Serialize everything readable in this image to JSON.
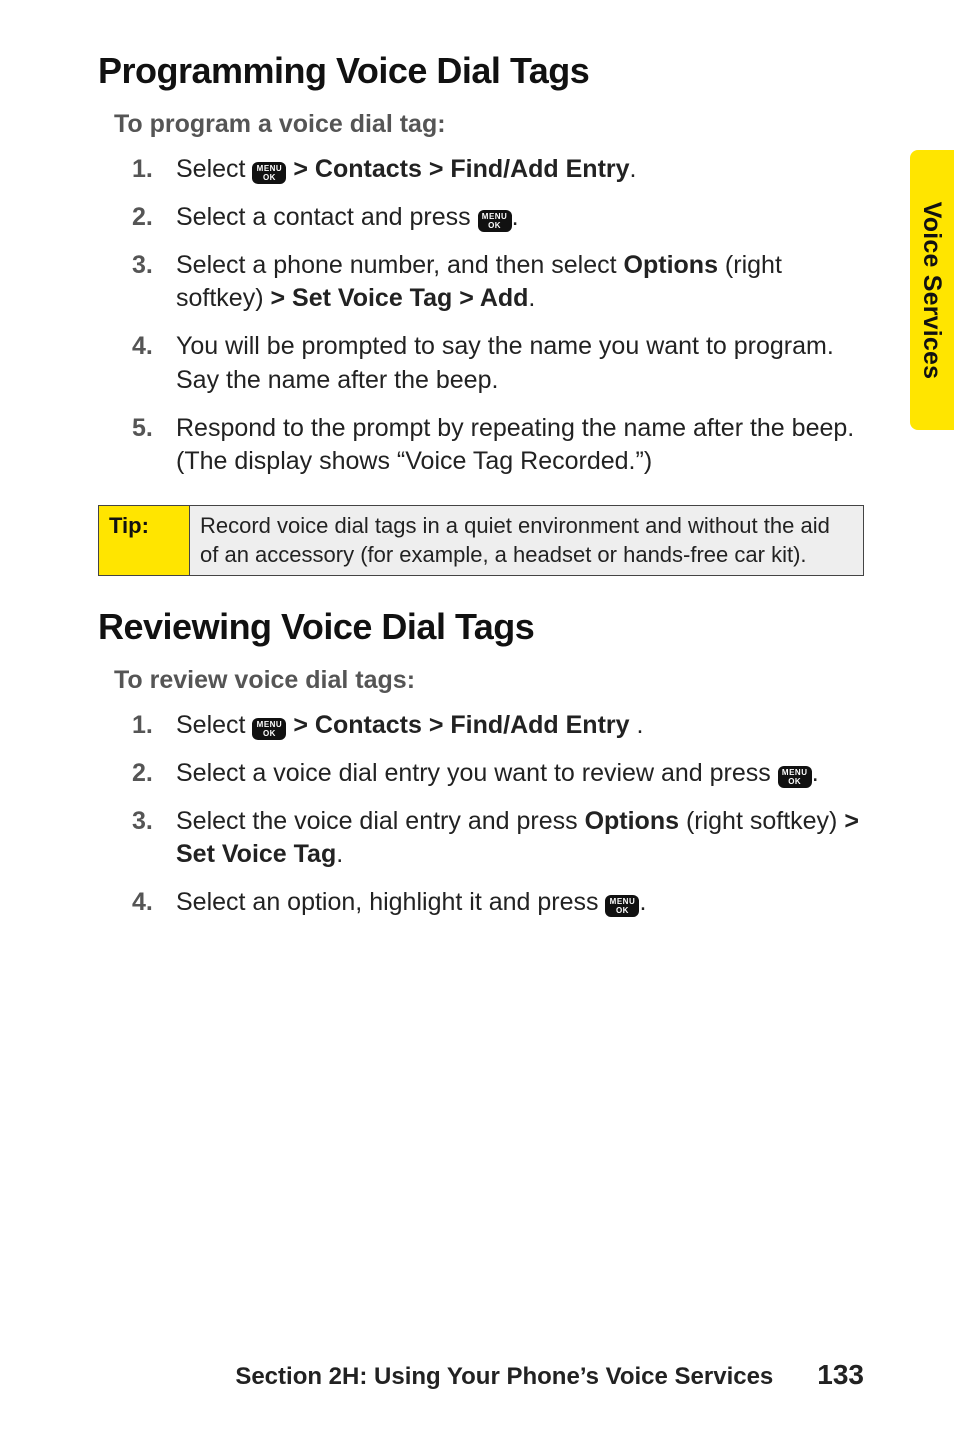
{
  "side_tab": {
    "label": "Voice Services"
  },
  "icons": {
    "menu_key_line1": "MENU",
    "menu_key_line2": "OK"
  },
  "section1": {
    "title": "Programming Voice Dial Tags",
    "lead": "To program a voice dial tag:",
    "steps": [
      {
        "pre": "Select ",
        "after_icon": " ",
        "strong": "> Contacts > Find/Add Entry",
        "post": "."
      },
      {
        "pre": "Select a contact and press ",
        "after_icon": ".",
        "strong": "",
        "post": ""
      },
      {
        "pre": "Select a phone number, and then select ",
        "strong1": "Options",
        "mid1": " (right softkey) ",
        "strong2": "> Set Voice Tag > Add",
        "post": "."
      },
      {
        "pre": "You will be prompted to say the name you want to program. Say the name after the beep.",
        "strong": "",
        "post": ""
      },
      {
        "pre": "Respond to the prompt by repeating the name after the beep. (The display shows “Voice Tag Recorded.”)",
        "strong": "",
        "post": ""
      }
    ]
  },
  "tip": {
    "label": "Tip:",
    "body": "Record voice dial tags in a quiet environment and without the aid of an accessory (for example, a headset or hands-free car kit)."
  },
  "section2": {
    "title": "Reviewing Voice Dial Tags",
    "lead": "To review voice dial tags:",
    "steps": [
      {
        "pre": "Select ",
        "after_icon": " ",
        "strong": "> Contacts > Find/Add Entry",
        "post": " ."
      },
      {
        "pre": "Select a voice dial entry you want to review and press ",
        "after_icon": ".",
        "strong": "",
        "post": ""
      },
      {
        "pre": "Select the voice dial entry and press ",
        "strong1": "Options",
        "mid1": " (right softkey) ",
        "strong2": "> Set Voice Tag",
        "post": "."
      },
      {
        "pre": "Select an option, highlight it and press ",
        "after_icon": ".",
        "strong": "",
        "post": ""
      }
    ]
  },
  "footer": {
    "section_label": "Section 2H: Using Your Phone’s Voice Services",
    "page_number": "133"
  }
}
